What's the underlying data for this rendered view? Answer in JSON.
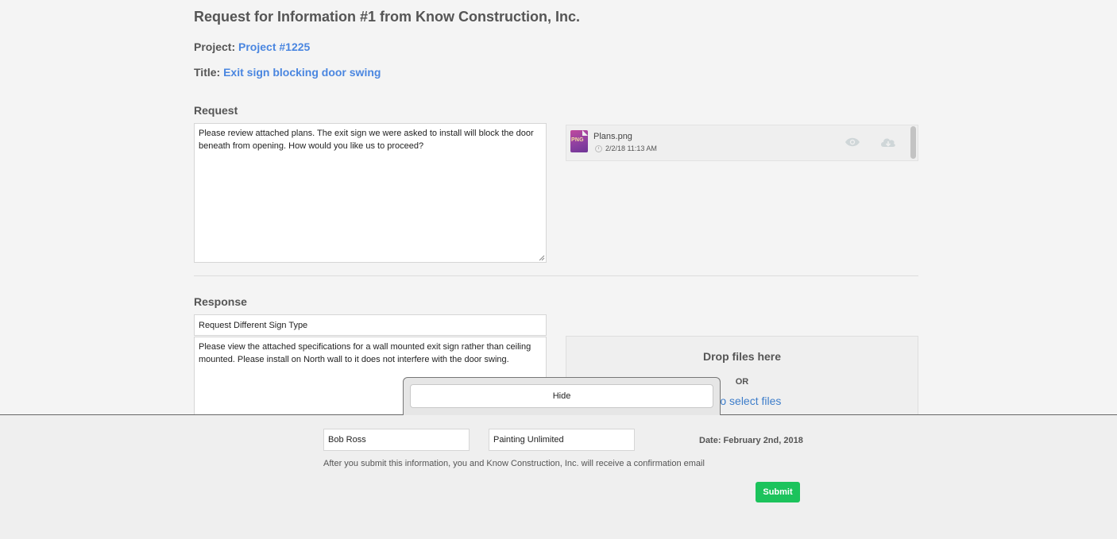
{
  "header": {
    "title": "Request for Information #1 from Know Construction, Inc.",
    "project_label": "Project:",
    "project_value": "Project #1225",
    "title_label": "Title:",
    "title_value": "Exit sign blocking door swing"
  },
  "request": {
    "label": "Request",
    "text": "Please review attached plans. The exit sign we were asked to install will block the door beneath from opening. How would you like us to proceed?",
    "attachments": [
      {
        "file_type": "PNG",
        "name": "Plans.png",
        "date": "2/2/18 11:13 AM",
        "icons": [
          "clock-icon",
          "eye-icon",
          "cloud-download-icon"
        ]
      }
    ]
  },
  "response": {
    "label": "Response",
    "subject": "Request Different Sign Type",
    "text": "Please view the attached specifications for a wall mounted exit sign rather than ceiling mounted. Please install on North wall to it does not interfere with the door swing.",
    "dropzone": {
      "title": "Drop files here",
      "or": "OR",
      "link": "ck to select files"
    }
  },
  "popup": {
    "hide_label": "Hide"
  },
  "footer": {
    "name": "Bob Ross",
    "company": "Painting Unlimited",
    "date": "Date: February 2nd, 2018",
    "note": "After you submit this information, you and Know Construction, Inc. will receive a confirmation email",
    "submit_label": "Submit"
  },
  "colors": {
    "link": "#4a86e0",
    "submit": "#1cc35c",
    "background": "#f4f4f4"
  }
}
